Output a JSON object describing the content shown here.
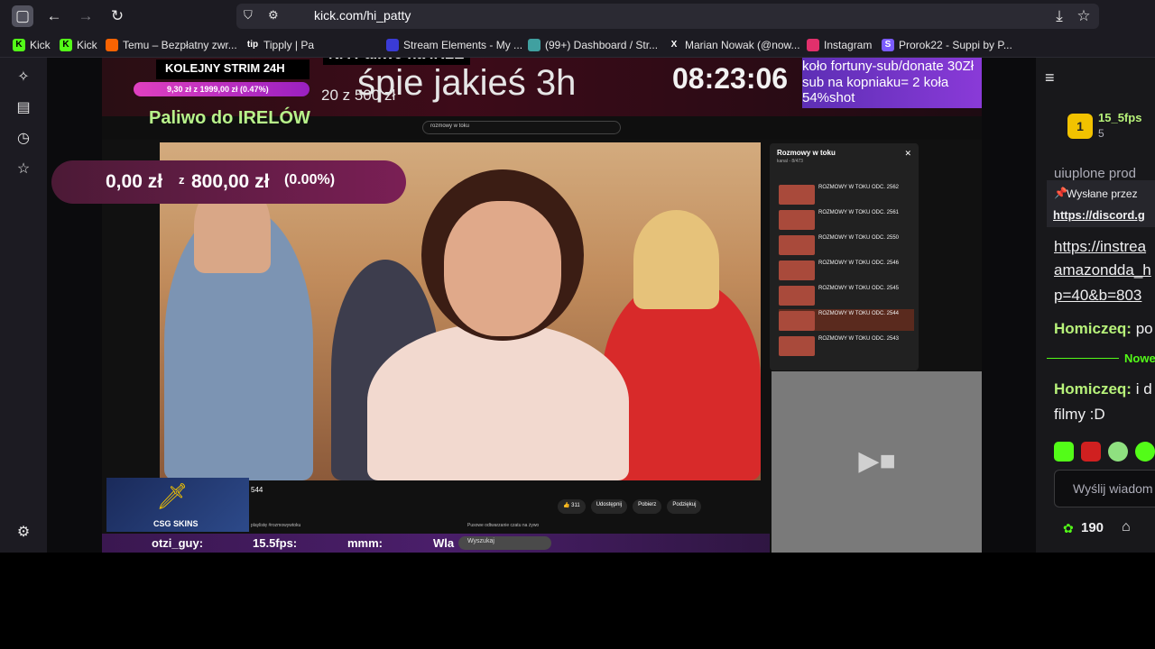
{
  "browser": {
    "url": "kick.com/hi_patty",
    "bookmarks": [
      {
        "label": "Kick",
        "color": "#53fc18",
        "icon": "kick-icon"
      },
      {
        "label": "Kick",
        "color": "#53fc18",
        "icon": "kick-icon"
      },
      {
        "label": "Temu – Bezpłatny zwr...",
        "color": "#f96302",
        "icon": "temu-icon"
      },
      {
        "label": "Tipply | Pa",
        "color": "#ffffff",
        "icon": "tipply-icon"
      },
      {
        "label": "Stream Elements - My ...",
        "color": "#3a3bd6",
        "icon": "streamelements-icon"
      },
      {
        "label": "(99+) Dashboard / Str...",
        "color": "#40a0a0",
        "icon": "dashboard-icon"
      },
      {
        "label": "Marian Nowak (@now...",
        "color": "#ffffff",
        "icon": "x-icon"
      },
      {
        "label": "Instagram",
        "color": "#e1306c",
        "icon": "instagram-icon"
      },
      {
        "label": "Prorok22 - Suppi by P...",
        "color": "#7b5cff",
        "icon": "suppi-icon"
      }
    ]
  },
  "overlay": {
    "kolejny": "KOLEJNY STRIM 24H",
    "na_paliwo": "NA Paliwo na IRLE",
    "spie": "śpie jakieś 3h",
    "timer": "08:23:06",
    "progress_top": "9,30 zł z 1999,00 zł (0.47%)",
    "count_line": "20 z 500 zł",
    "paliwo": "Paliwo do IRELÓW",
    "goal_amount": "0,00 zł",
    "goal_z": "z",
    "goal_target": "800,00 zł",
    "goal_pct": "(0.00%)",
    "wheel_line1": "koło fortuny-sub/donate 30Zł",
    "wheel_line2": "sub na kopniaku= 2 koła",
    "wheel_line3": "54%shot",
    "csgo": "CSG SKINS",
    "ticker_items": [
      "otzi_guy:",
      "15.5fps:",
      "mmm:",
      "Wla"
    ],
    "ticker_search": "Wyszukaj"
  },
  "youtube": {
    "search_text": "rozmowy w toku",
    "side_title": "Rozmowy w toku",
    "side_sub": "kanal - 8/473",
    "rows": [
      "ROZMOWY W TOKU ODC. 2562",
      "ROZMOWY W TOKU ODC. 2561",
      "ROZMOWY W TOKU ODC. 2550",
      "ROZMOWY W TOKU ODC. 2546",
      "ROZMOWY W TOKU ODC. 2545",
      "ROZMOWY W TOKU ODC. 2544",
      "ROZMOWY W TOKU ODC. 2543"
    ],
    "bottom_count": "544",
    "like_count": "311",
    "share_label": "Udostępnij",
    "download_label": "Pobierz",
    "thanks_label": "Podziękuj",
    "upnext_a": "playlistę #rozmowywtoku",
    "upnext_b": "Pusowe odtwarzanie czatu na żywo"
  },
  "chat": {
    "top_user": "15_5fps",
    "top_rank": "1",
    "top_count": "5",
    "trunc_top": "uiuplone prod",
    "pinned_label": "Wysłane przez",
    "pinned_link": "https://discord.g",
    "msg_link1": "https://instrea",
    "msg_link2": "amazondda_h",
    "msg_link3": "p=40&b=803",
    "msg1_user": "Homiczeq:",
    "msg1_text": " po",
    "divider": "Nowe",
    "msg2_user": "Homiczeq:",
    "msg2_text": " i d",
    "msg2_line2": "filmy :D",
    "input_placeholder": "Wyślij wiadom",
    "points": "190"
  }
}
